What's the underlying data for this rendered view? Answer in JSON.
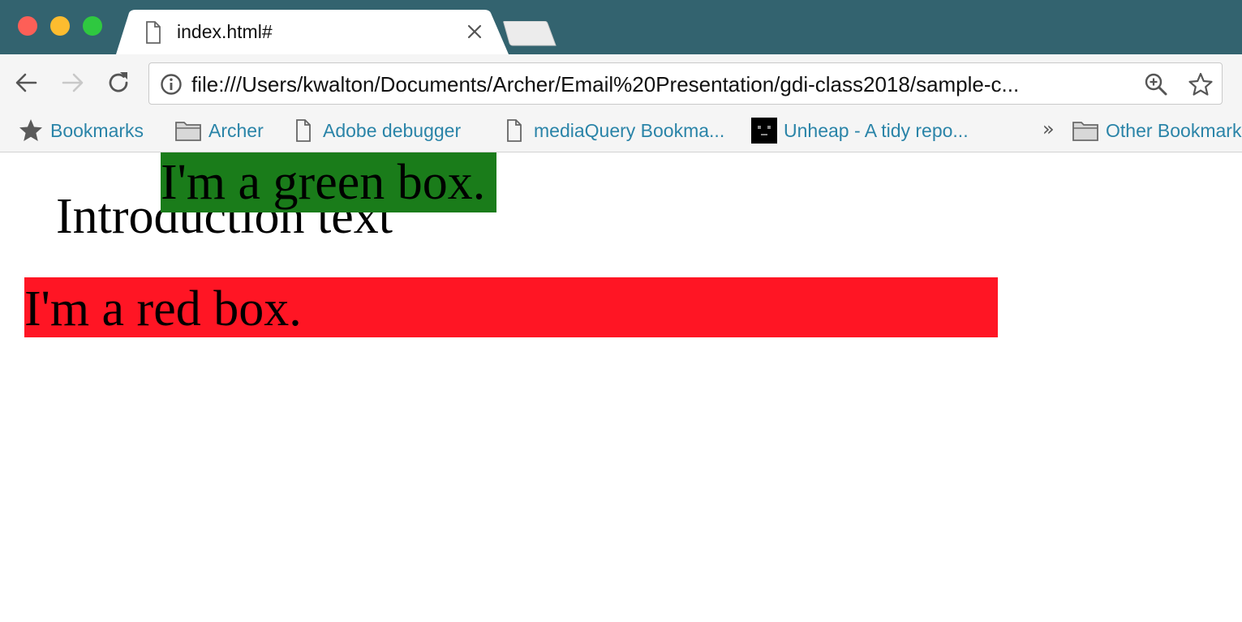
{
  "tab": {
    "title": "index.html#"
  },
  "address_bar": {
    "url": "file:///Users/kwalton/Documents/Archer/Email%20Presentation/gdi-class2018/sample-c..."
  },
  "bookmarks_bar": {
    "items": [
      {
        "label": "Bookmarks",
        "icon": "star-icon"
      },
      {
        "label": "Archer",
        "icon": "folder-icon"
      },
      {
        "label": "Adobe debugger",
        "icon": "page-icon"
      },
      {
        "label": "mediaQuery Bookma...",
        "icon": "page-icon"
      },
      {
        "label": "Unheap - A tidy repo...",
        "icon": "robot-favicon-icon"
      }
    ],
    "overflow": "»",
    "other": {
      "label": "Other Bookmarks",
      "icon": "folder-icon"
    }
  },
  "page": {
    "intro_text": "Introduction text",
    "green_box_text": "I'm a green box.",
    "red_box_text": "I'm a red box."
  },
  "colors": {
    "tabstrip": "#33636f",
    "link": "#2a84a8",
    "green_box": "#1a7c1a",
    "red_box": "#ff1524"
  }
}
